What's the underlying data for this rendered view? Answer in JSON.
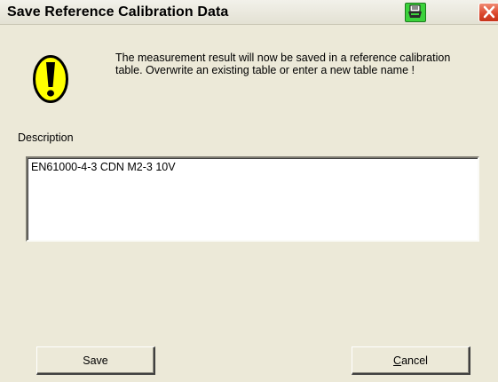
{
  "window": {
    "title": "Save Reference Calibration Data",
    "icons": {
      "print": "printer-icon",
      "close": "close-icon"
    }
  },
  "message": {
    "icon": "exclamation-warning-icon",
    "text": "The measurement result will now be saved in a reference calibration table. Overwrite an existing table or enter a new table name !"
  },
  "description": {
    "label": "Description",
    "value": "EN61000-4-3 CDN M2-3 10V"
  },
  "buttons": {
    "save_label": "Save",
    "cancel_label": "Cancel"
  },
  "colors": {
    "dialog_background": "#ece9d8",
    "warning_yellow": "#ffff00",
    "close_red": "#d9452a",
    "print_green": "#3bd23b"
  }
}
